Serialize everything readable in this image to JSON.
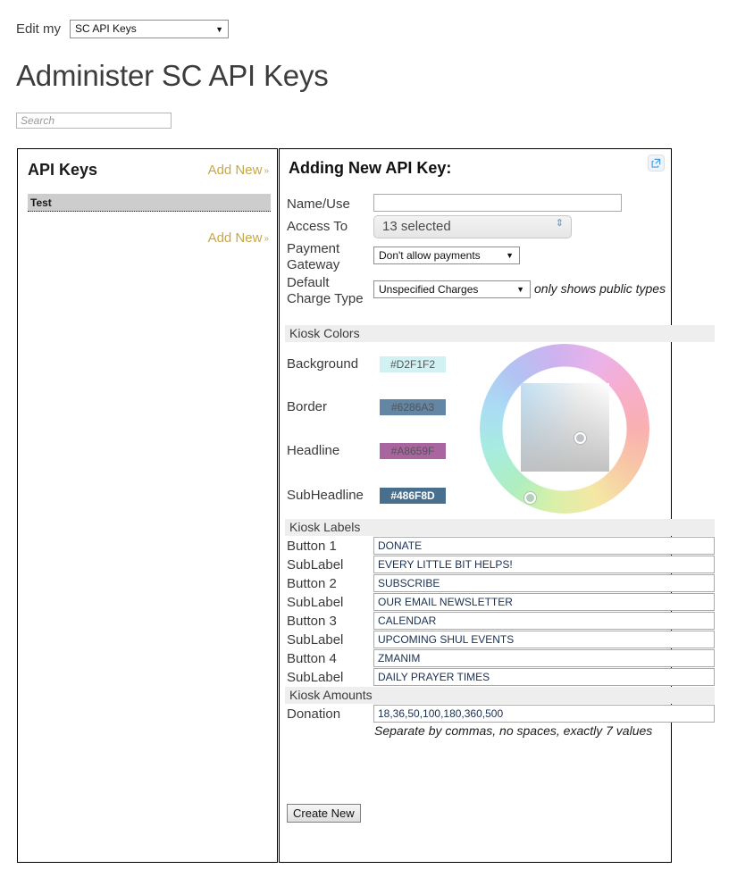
{
  "topbar": {
    "label": "Edit my",
    "selected": "SC API Keys",
    "caret": "▼"
  },
  "page_title": "Administer SC API Keys",
  "search": {
    "value": "",
    "placeholder": "Search"
  },
  "left_panel": {
    "title": "API Keys",
    "add_new_top": "Add New",
    "add_new_bottom": "Add New",
    "chevron": "»",
    "items": [
      {
        "label": "Test",
        "selected": true
      }
    ]
  },
  "right_panel": {
    "title": "Adding New API Key:",
    "popout_icon": "external-link-icon",
    "fields": {
      "name_use": {
        "label": "Name/Use",
        "value": "",
        "placeholder": ""
      },
      "access_to": {
        "label": "Access To",
        "value": "13 selected"
      },
      "payment_gateway": {
        "label": "Payment Gateway",
        "value": "Don't allow payments"
      },
      "default_charge_type": {
        "label": "Default Charge Type",
        "value": "Unspecified Charges",
        "hint": "only shows public types"
      }
    },
    "sections": {
      "colors": "Kiosk Colors",
      "labels": "Kiosk Labels",
      "amounts": "Kiosk Amounts"
    },
    "colors": [
      {
        "label": "Background",
        "value": "#D2F1F2",
        "text_color": "#555555"
      },
      {
        "label": "Border",
        "value": "#6286A3",
        "text_color": "#555555"
      },
      {
        "label": "Headline",
        "value": "#A8659F",
        "text_color": "#555555"
      },
      {
        "label": "SubHeadline",
        "value": "#486F8D",
        "text_color": "#ffffff"
      }
    ],
    "labels": [
      {
        "label": "Button 1",
        "value": "DONATE"
      },
      {
        "label": "SubLabel",
        "value": "EVERY LITTLE BIT HELPS!"
      },
      {
        "label": "Button 2",
        "value": "SUBSCRIBE"
      },
      {
        "label": "SubLabel",
        "value": "OUR EMAIL NEWSLETTER"
      },
      {
        "label": "Button 3",
        "value": "CALENDAR"
      },
      {
        "label": "SubLabel",
        "value": "UPCOMING SHUL EVENTS"
      },
      {
        "label": "Button 4",
        "value": "ZMANIM"
      },
      {
        "label": "SubLabel",
        "value": "DAILY PRAYER TIMES"
      }
    ],
    "amounts": {
      "label": "Donation",
      "value": "18,36,50,100,180,360,500",
      "hint": "Separate by commas, no spaces, exactly 7 values"
    },
    "create_button": "Create New",
    "caret": "▼",
    "spinner": "⇕"
  }
}
